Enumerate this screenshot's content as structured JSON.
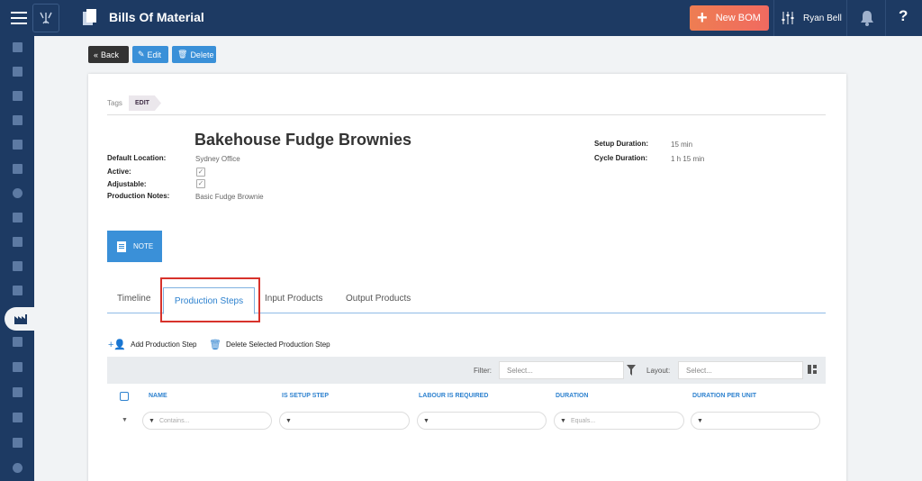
{
  "header": {
    "title": "Bills Of Material",
    "new_button": "New BOM",
    "user_name": "Ryan Bell",
    "help_label": "?"
  },
  "nav": {
    "icons": [
      "building-icon",
      "id-card-icon",
      "filter-icon",
      "document-icon",
      "calendar-icon",
      "calendar-icon",
      "dollar-icon",
      "document-icon",
      "people-icon",
      "list-icon",
      "sitemap-icon",
      "factory-icon",
      "chart-icon",
      "table-icon",
      "report-icon",
      "graduation-icon",
      "heart-icon",
      "gear-icon"
    ],
    "active": "factory-icon"
  },
  "toolbar": {
    "back": "Back",
    "edit": "Edit",
    "delete": "Delete"
  },
  "tags": {
    "label": "Tags",
    "edit": "EDIT"
  },
  "bom": {
    "name": "Bakehouse Fudge Brownies",
    "default_location_label": "Default Location:",
    "default_location": "Sydney Office",
    "active_label": "Active:",
    "active": true,
    "adjustable_label": "Adjustable:",
    "adjustable": true,
    "notes_label": "Production Notes:",
    "notes": "Basic Fudge Brownie",
    "setup_label": "Setup Duration:",
    "setup": "15 min",
    "cycle_label": "Cycle Duration:",
    "cycle": "1 h 15 min"
  },
  "note_button": "NOTE",
  "tabs": [
    "Timeline",
    "Production Steps",
    "Input Products",
    "Output Products"
  ],
  "active_tab": "Production Steps",
  "actions": {
    "add": "Add Production Step",
    "delete": "Delete Selected Production Step"
  },
  "grid": {
    "filter_label": "Filter:",
    "filter_placeholder": "Select...",
    "layout_label": "Layout:",
    "layout_placeholder": "Select...",
    "columns": [
      "NAME",
      "IS SETUP STEP",
      "LABOUR IS REQUIRED",
      "DURATION",
      "DURATION PER UNIT"
    ],
    "filters": [
      "Contains...",
      "",
      "",
      "Equals...",
      ""
    ]
  },
  "colors": {
    "navy": "#1d3a63",
    "accent_blue": "#3a90d8",
    "new_button": "#ee7d52",
    "highlight": "#d7322b"
  }
}
